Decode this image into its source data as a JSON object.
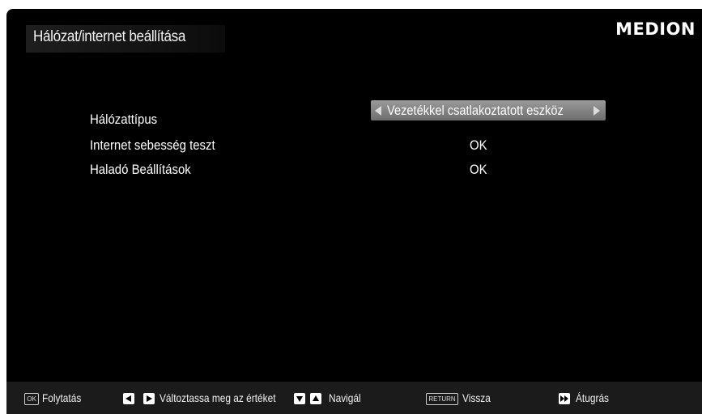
{
  "header": {
    "title": "Hálózat/internet beállítása",
    "brand": "MEDION"
  },
  "settings": [
    {
      "label": "Hálózattípus",
      "value": "Vezetékkel csatlakoztatott eszköz"
    },
    {
      "label": "Internet sebesség teszt",
      "value": "OK"
    },
    {
      "label": "Haladó Beállítások",
      "value": "OK"
    }
  ],
  "footer": {
    "ok_key": "OK",
    "continue_label": "Folytatás",
    "change_label": "Változtassa meg az értéket",
    "navigate_label": "Navigál",
    "return_key": "RETURN",
    "back_label": "Vissza",
    "skip_label": "Átugrás"
  },
  "colors": {
    "background": "#000000",
    "selection": "#8a8a8a",
    "footer": "#1b1b1b",
    "text": "#ffffff"
  },
  "icons": [
    "arrow-left-icon",
    "arrow-right-icon",
    "arrow-down-icon",
    "arrow-up-icon",
    "fast-forward-icon"
  ]
}
